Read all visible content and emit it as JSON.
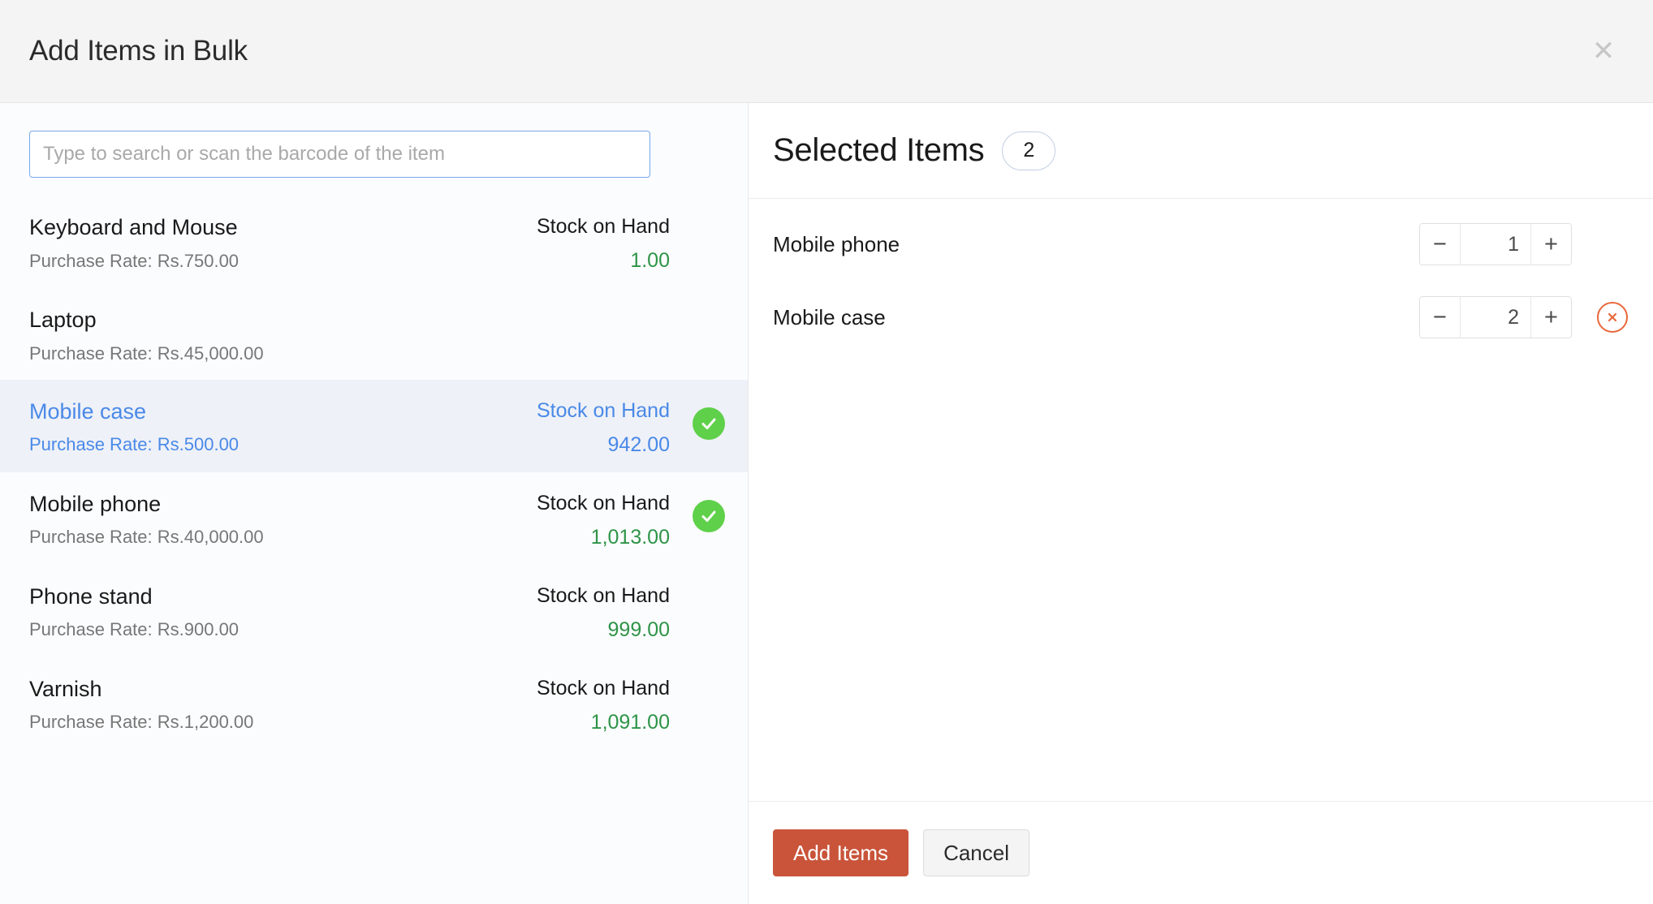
{
  "modal": {
    "title": "Add Items in Bulk",
    "close_icon": "close-icon"
  },
  "search": {
    "placeholder": "Type to search or scan the barcode of the item",
    "value": ""
  },
  "item_list": {
    "stock_label": "Stock on Hand",
    "items": [
      {
        "name": "Keyboard and Mouse",
        "rate": "Purchase Rate: Rs.750.00",
        "stock_label": "Stock on Hand",
        "stock_value": "1.00",
        "selected": false,
        "highlighted": false,
        "has_stock": true
      },
      {
        "name": "Laptop",
        "rate": "Purchase Rate: Rs.45,000.00",
        "stock_label": "",
        "stock_value": "",
        "selected": false,
        "highlighted": false,
        "has_stock": false
      },
      {
        "name": "Mobile case",
        "rate": "Purchase Rate: Rs.500.00",
        "stock_label": "Stock on Hand",
        "stock_value": "942.00",
        "selected": true,
        "highlighted": true,
        "has_stock": true
      },
      {
        "name": "Mobile phone",
        "rate": "Purchase Rate: Rs.40,000.00",
        "stock_label": "Stock on Hand",
        "stock_value": "1,013.00",
        "selected": true,
        "highlighted": false,
        "has_stock": true
      },
      {
        "name": "Phone stand",
        "rate": "Purchase Rate: Rs.900.00",
        "stock_label": "Stock on Hand",
        "stock_value": "999.00",
        "selected": false,
        "highlighted": false,
        "has_stock": true
      },
      {
        "name": "Varnish",
        "rate": "Purchase Rate: Rs.1,200.00",
        "stock_label": "Stock on Hand",
        "stock_value": "1,091.00",
        "selected": false,
        "highlighted": false,
        "has_stock": true
      }
    ]
  },
  "selected_panel": {
    "title": "Selected Items",
    "count": "2",
    "decrement_label": "−",
    "increment_label": "+",
    "rows": [
      {
        "name": "Mobile phone",
        "quantity": "1",
        "removable": false
      },
      {
        "name": "Mobile case",
        "quantity": "2",
        "removable": true
      }
    ]
  },
  "footer": {
    "primary_label": "Add Items",
    "secondary_label": "Cancel"
  },
  "colors": {
    "primary_button": "#c9543a",
    "accent_blue": "#4a89e8",
    "stock_green": "#2e9447",
    "check_green": "#5fd04a",
    "remove_orange": "#e8683c",
    "header_bg": "#f4f4f4",
    "left_panel_bg": "#fbfcfe",
    "highlight_row_bg": "#eef1f7"
  }
}
